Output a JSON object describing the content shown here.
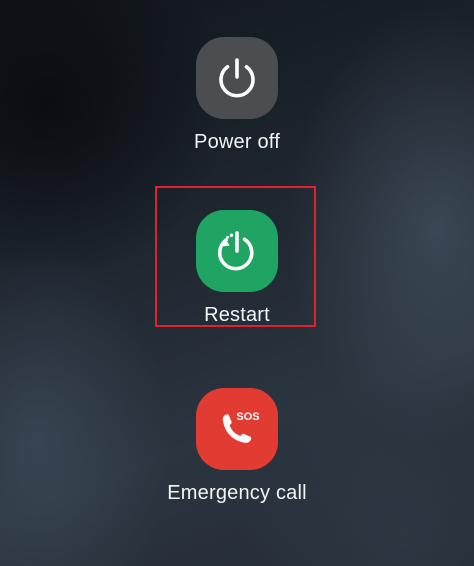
{
  "power_menu": {
    "power_off": {
      "label": "Power off",
      "icon": "power-icon",
      "color": "#4b4d51"
    },
    "restart": {
      "label": "Restart",
      "icon": "restart-icon",
      "color": "#1fa463"
    },
    "emergency_call": {
      "label": "Emergency call",
      "icon": "emergency-call-icon",
      "badge": "SOS",
      "color": "#e23b32"
    }
  },
  "highlight": {
    "color": "#e0222c"
  }
}
